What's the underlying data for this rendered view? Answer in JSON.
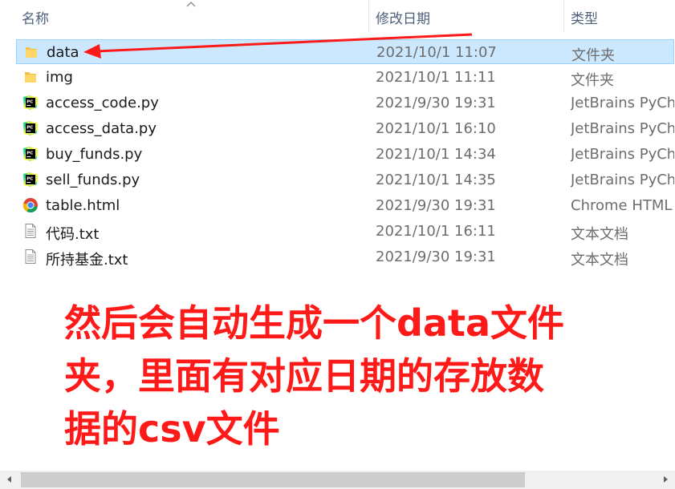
{
  "columns": {
    "name": "名称",
    "date": "修改日期",
    "type": "类型"
  },
  "files": [
    {
      "name": "data",
      "date": "2021/10/1 11:07",
      "type": "文件夹",
      "icon": "folder-icon",
      "selected": true
    },
    {
      "name": "img",
      "date": "2021/10/1 11:11",
      "type": "文件夹",
      "icon": "folder-icon"
    },
    {
      "name": "access_code.py",
      "date": "2021/9/30 19:31",
      "type": "JetBrains PyCha",
      "icon": "pycharm-icon"
    },
    {
      "name": "access_data.py",
      "date": "2021/10/1 16:10",
      "type": "JetBrains PyCha",
      "icon": "pycharm-icon"
    },
    {
      "name": "buy_funds.py",
      "date": "2021/10/1 14:34",
      "type": "JetBrains PyCha",
      "icon": "pycharm-icon"
    },
    {
      "name": "sell_funds.py",
      "date": "2021/10/1 14:35",
      "type": "JetBrains PyCha",
      "icon": "pycharm-icon"
    },
    {
      "name": "table.html",
      "date": "2021/9/30 19:31",
      "type": "Chrome HTML",
      "icon": "chrome-icon"
    },
    {
      "name": "代码.txt",
      "date": "2021/10/1 16:11",
      "type": "文本文档",
      "icon": "text-file-icon"
    },
    {
      "name": "所持基金.txt",
      "date": "2021/9/30 19:31",
      "type": "文本文档",
      "icon": "text-file-icon"
    }
  ],
  "annotation": {
    "lines": [
      "然后会自动生成一个data文件",
      "夹，里面有对应日期的存放数",
      "据的csv文件"
    ],
    "color": "#ff1a1a"
  },
  "colors": {
    "selected_bg": "#cce8ff",
    "selected_border": "#99d1ff",
    "header_text": "#4c607a"
  }
}
